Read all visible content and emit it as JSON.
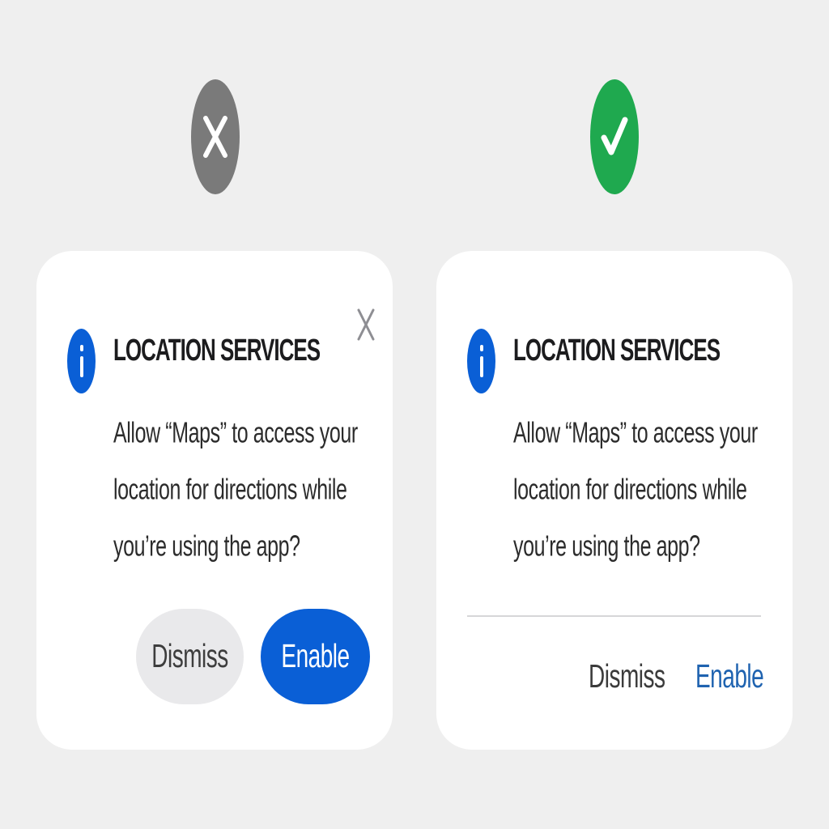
{
  "colors": {
    "background": "#efefef",
    "card": "#ffffff",
    "accent_blue": "#0a5fd6",
    "link_blue": "#1f63b0",
    "bad_badge": "#7a7a7a",
    "good_badge": "#1fa94f",
    "secondary_button": "#e9e9eb"
  },
  "examples": {
    "bad": {
      "verdict_icon": "x-mark-icon",
      "dialog": {
        "icon": "info-icon",
        "close_icon": "close-icon",
        "title": "LOCATION SERVICES",
        "message_lines": [
          "Allow “Maps” to access your",
          "location for directions while",
          "you’re using the app?"
        ],
        "dismiss_label": "Dismiss",
        "enable_label": "Enable"
      }
    },
    "good": {
      "verdict_icon": "checkmark-icon",
      "dialog": {
        "icon": "info-icon",
        "title": "LOCATION SERVICES",
        "message_lines": [
          "Allow “Maps” to access your",
          "location for directions while",
          "you’re using the app?"
        ],
        "dismiss_label": "Dismiss",
        "enable_label": "Enable"
      }
    }
  }
}
